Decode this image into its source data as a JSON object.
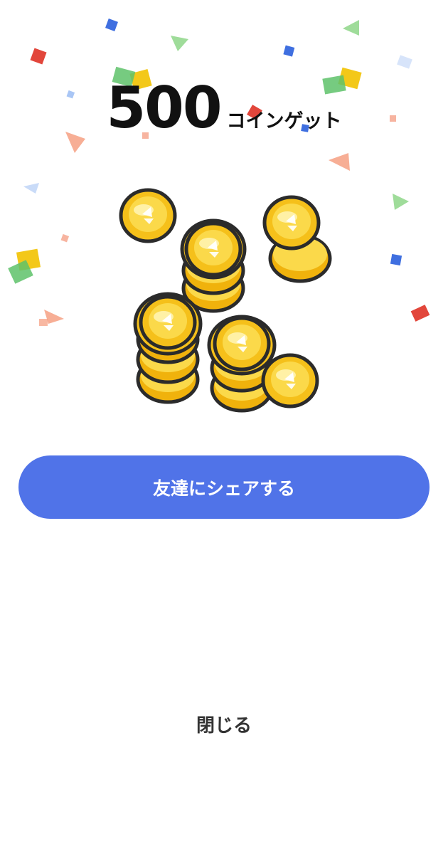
{
  "reward": {
    "amount": "500",
    "unit_label": "コインゲット"
  },
  "illustration": {
    "icon": "coin-stack-icon",
    "coin_color": "#f5c01a",
    "coin_outline": "#2b2b2b"
  },
  "actions": {
    "share_label": "友達にシェアする",
    "close_label": "閉じる"
  },
  "colors": {
    "primary": "#5073e8",
    "background": "#ffffff",
    "confetti": [
      "#e2463b",
      "#3f6fe0",
      "#f2c200",
      "#5ec26a",
      "#f59a7a",
      "#a9c6f5"
    ]
  }
}
